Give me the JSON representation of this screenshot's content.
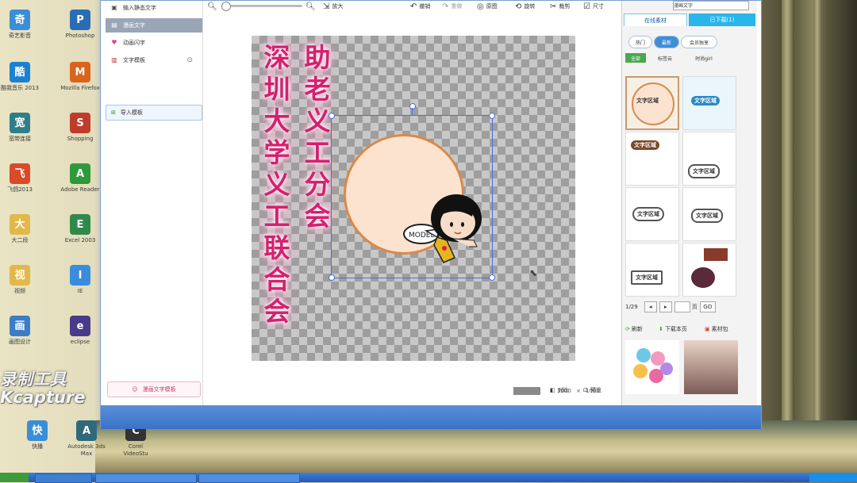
{
  "desktop": {
    "icons": [
      {
        "label": "奇艺影音",
        "icon": "qiyi-icon",
        "color": "#3a8ed6"
      },
      {
        "label": "Photoshop",
        "icon": "photoshop-icon",
        "color": "#2b6db3"
      },
      {
        "label": "酷我音乐 2013",
        "icon": "kuwo-icon",
        "color": "#1e80d0"
      },
      {
        "label": "Mozilla Firefox",
        "icon": "firefox-icon",
        "color": "#d8641e"
      },
      {
        "label": "宽带连接",
        "icon": "network-icon",
        "color": "#2e7f8a"
      },
      {
        "label": "Shopping",
        "icon": "shop-icon",
        "color": "#c03c2a"
      },
      {
        "label": "飞鸽2013",
        "icon": "feige-icon",
        "color": "#d84a2a"
      },
      {
        "label": "Adobe Reader",
        "icon": "reader-icon",
        "color": "#2e9a3a"
      },
      {
        "label": "大二段",
        "icon": "folder-icon",
        "color": "#e2b84a"
      },
      {
        "label": "Excel 2003",
        "icon": "excel-icon",
        "color": "#2f8a4a"
      },
      {
        "label": "视频",
        "icon": "folder-icon",
        "color": "#e2b84a"
      },
      {
        "label": "IE",
        "icon": "ie-icon",
        "color": "#3b8cdc"
      },
      {
        "label": "画图设计",
        "icon": "paint-icon",
        "color": "#3d7cc6"
      },
      {
        "label": "eclipse",
        "icon": "eclipse-icon",
        "color": "#4a3a8a"
      },
      {
        "label": "快播",
        "icon": "kuaibo-icon",
        "color": "#3a8ed6"
      },
      {
        "label": "Autodesk 3ds Max",
        "icon": "3dsmax-icon",
        "color": "#2f6a7a"
      },
      {
        "label": "Corel VideoStu",
        "icon": "corel-icon",
        "color": "#333333"
      }
    ],
    "watermark_line1": "录制工具",
    "watermark_line2": "Kcapture"
  },
  "left_panel": {
    "items": [
      {
        "label": "输入静态文字",
        "icon": "text-icon"
      },
      {
        "label": "漫画文字",
        "icon": "comic-text-icon"
      },
      {
        "label": "动画闪字",
        "icon": "heart-icon"
      },
      {
        "label": "文字模板",
        "icon": "template-icon"
      }
    ],
    "import_button": "导入模板",
    "bottom_button": "漫画文字模板"
  },
  "toolbar": {
    "zoom_label": "放大",
    "undo": "撤销",
    "redo": "重做",
    "original": "原图",
    "rotate": "旋转",
    "crop": "裁剪",
    "resize": "尺寸"
  },
  "canvas": {
    "column1": "深圳大学义工联合会",
    "column2": "助老义工分会",
    "bubble_text": "MODEL"
  },
  "bottom_bar": {
    "width": "1000",
    "times": "×",
    "height": "1000",
    "compare": "对比",
    "preview": "预览"
  },
  "right_panel": {
    "select_value": "漫画文字",
    "tabs": [
      "在线素材",
      "已下载(1)"
    ],
    "pills": [
      "热门",
      "最新",
      "会员独享"
    ],
    "subtabs": [
      "全部",
      "标签云",
      "时尚girl"
    ],
    "tile_label": "文字区域",
    "pager_text": "1/29",
    "page_input": "",
    "go": "GO",
    "page_unit": "页",
    "actions": [
      "刷新",
      "下载本页",
      "素材包"
    ]
  },
  "colors": {
    "title_text": "#d4216e",
    "title_glow": "#f4a6ca",
    "selection_box": "#4a6ed8",
    "frame_fill": "#fbe3cf",
    "frame_border": "#d9894a"
  }
}
